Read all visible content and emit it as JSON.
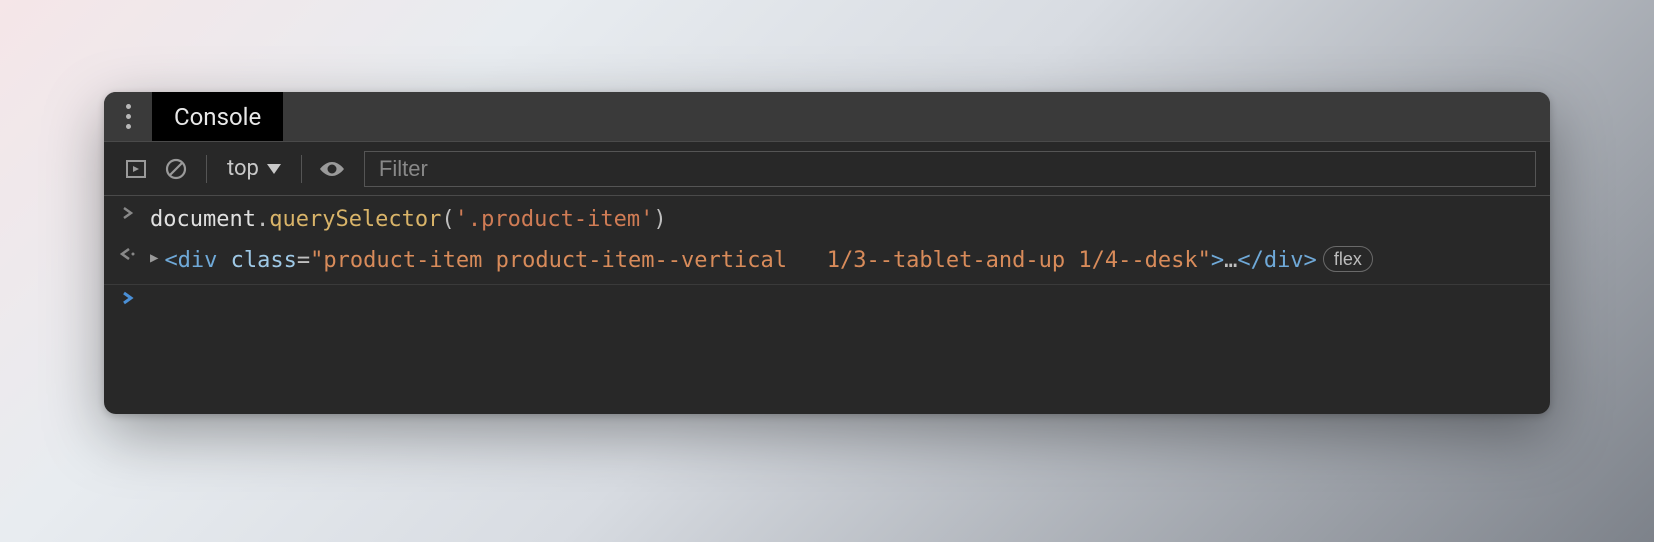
{
  "tabbar": {
    "active_tab": "Console"
  },
  "toolbar": {
    "context_label": "top",
    "filter_placeholder": "Filter"
  },
  "console": {
    "input_line": {
      "object": "document",
      "dot": ".",
      "method": "querySelector",
      "open_paren": "(",
      "string": "'.product-item'",
      "close_paren": ")"
    },
    "result_line": {
      "open_tag": "<div",
      "space1": " ",
      "attr_name": "class",
      "equals": "=",
      "attr_value": "\"product-item product-item--vertical   1/3--tablet-and-up 1/4--desk\"",
      "close_angle": ">",
      "ellipsis": "…",
      "close_tag": "</div>",
      "badge": "flex"
    }
  }
}
